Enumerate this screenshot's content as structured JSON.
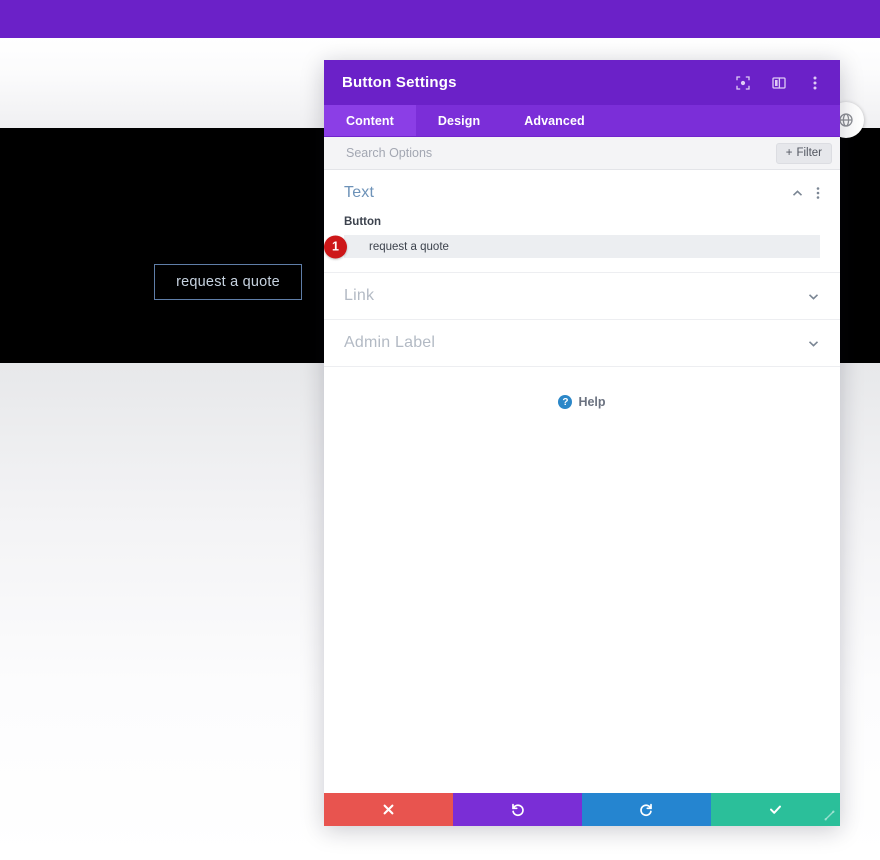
{
  "page": {
    "admin_bar": {
      "name": "wordpress-admin-bar"
    },
    "hero_button_label": "request a quote",
    "floating_action_name": "page-settings-fab"
  },
  "modal": {
    "title": "Button Settings",
    "titlebar_icons": [
      {
        "name": "fullscreen-icon"
      },
      {
        "name": "layout-panel-icon"
      },
      {
        "name": "more-vertical-icon"
      }
    ],
    "tabs": [
      {
        "label": "Content",
        "active": true
      },
      {
        "label": "Design",
        "active": false
      },
      {
        "label": "Advanced",
        "active": false
      }
    ],
    "search": {
      "placeholder": "Search Options",
      "value": ""
    },
    "filter_label": "Filter",
    "sections": [
      {
        "title": "Text",
        "expanded": true,
        "field_label": "Button",
        "field_value": "request a quote",
        "step_badge": "1"
      },
      {
        "title": "Link",
        "expanded": false
      },
      {
        "title": "Admin Label",
        "expanded": false
      }
    ],
    "help_label": "Help",
    "footer_buttons": [
      {
        "name": "cancel-button",
        "icon": "close-icon",
        "color": "#e8544f"
      },
      {
        "name": "undo-button",
        "icon": "undo-icon",
        "color": "#7a2ed6"
      },
      {
        "name": "redo-button",
        "icon": "redo-icon",
        "color": "#2585d0"
      },
      {
        "name": "save-button",
        "icon": "check-icon",
        "color": "#2bbf9a"
      }
    ]
  },
  "colors": {
    "brand_purple": "#6b21c8",
    "tab_active": "#8b3ee6",
    "section_open": "#6d92b8",
    "badge_red": "#cd1719",
    "help_blue": "#2b87c8"
  }
}
